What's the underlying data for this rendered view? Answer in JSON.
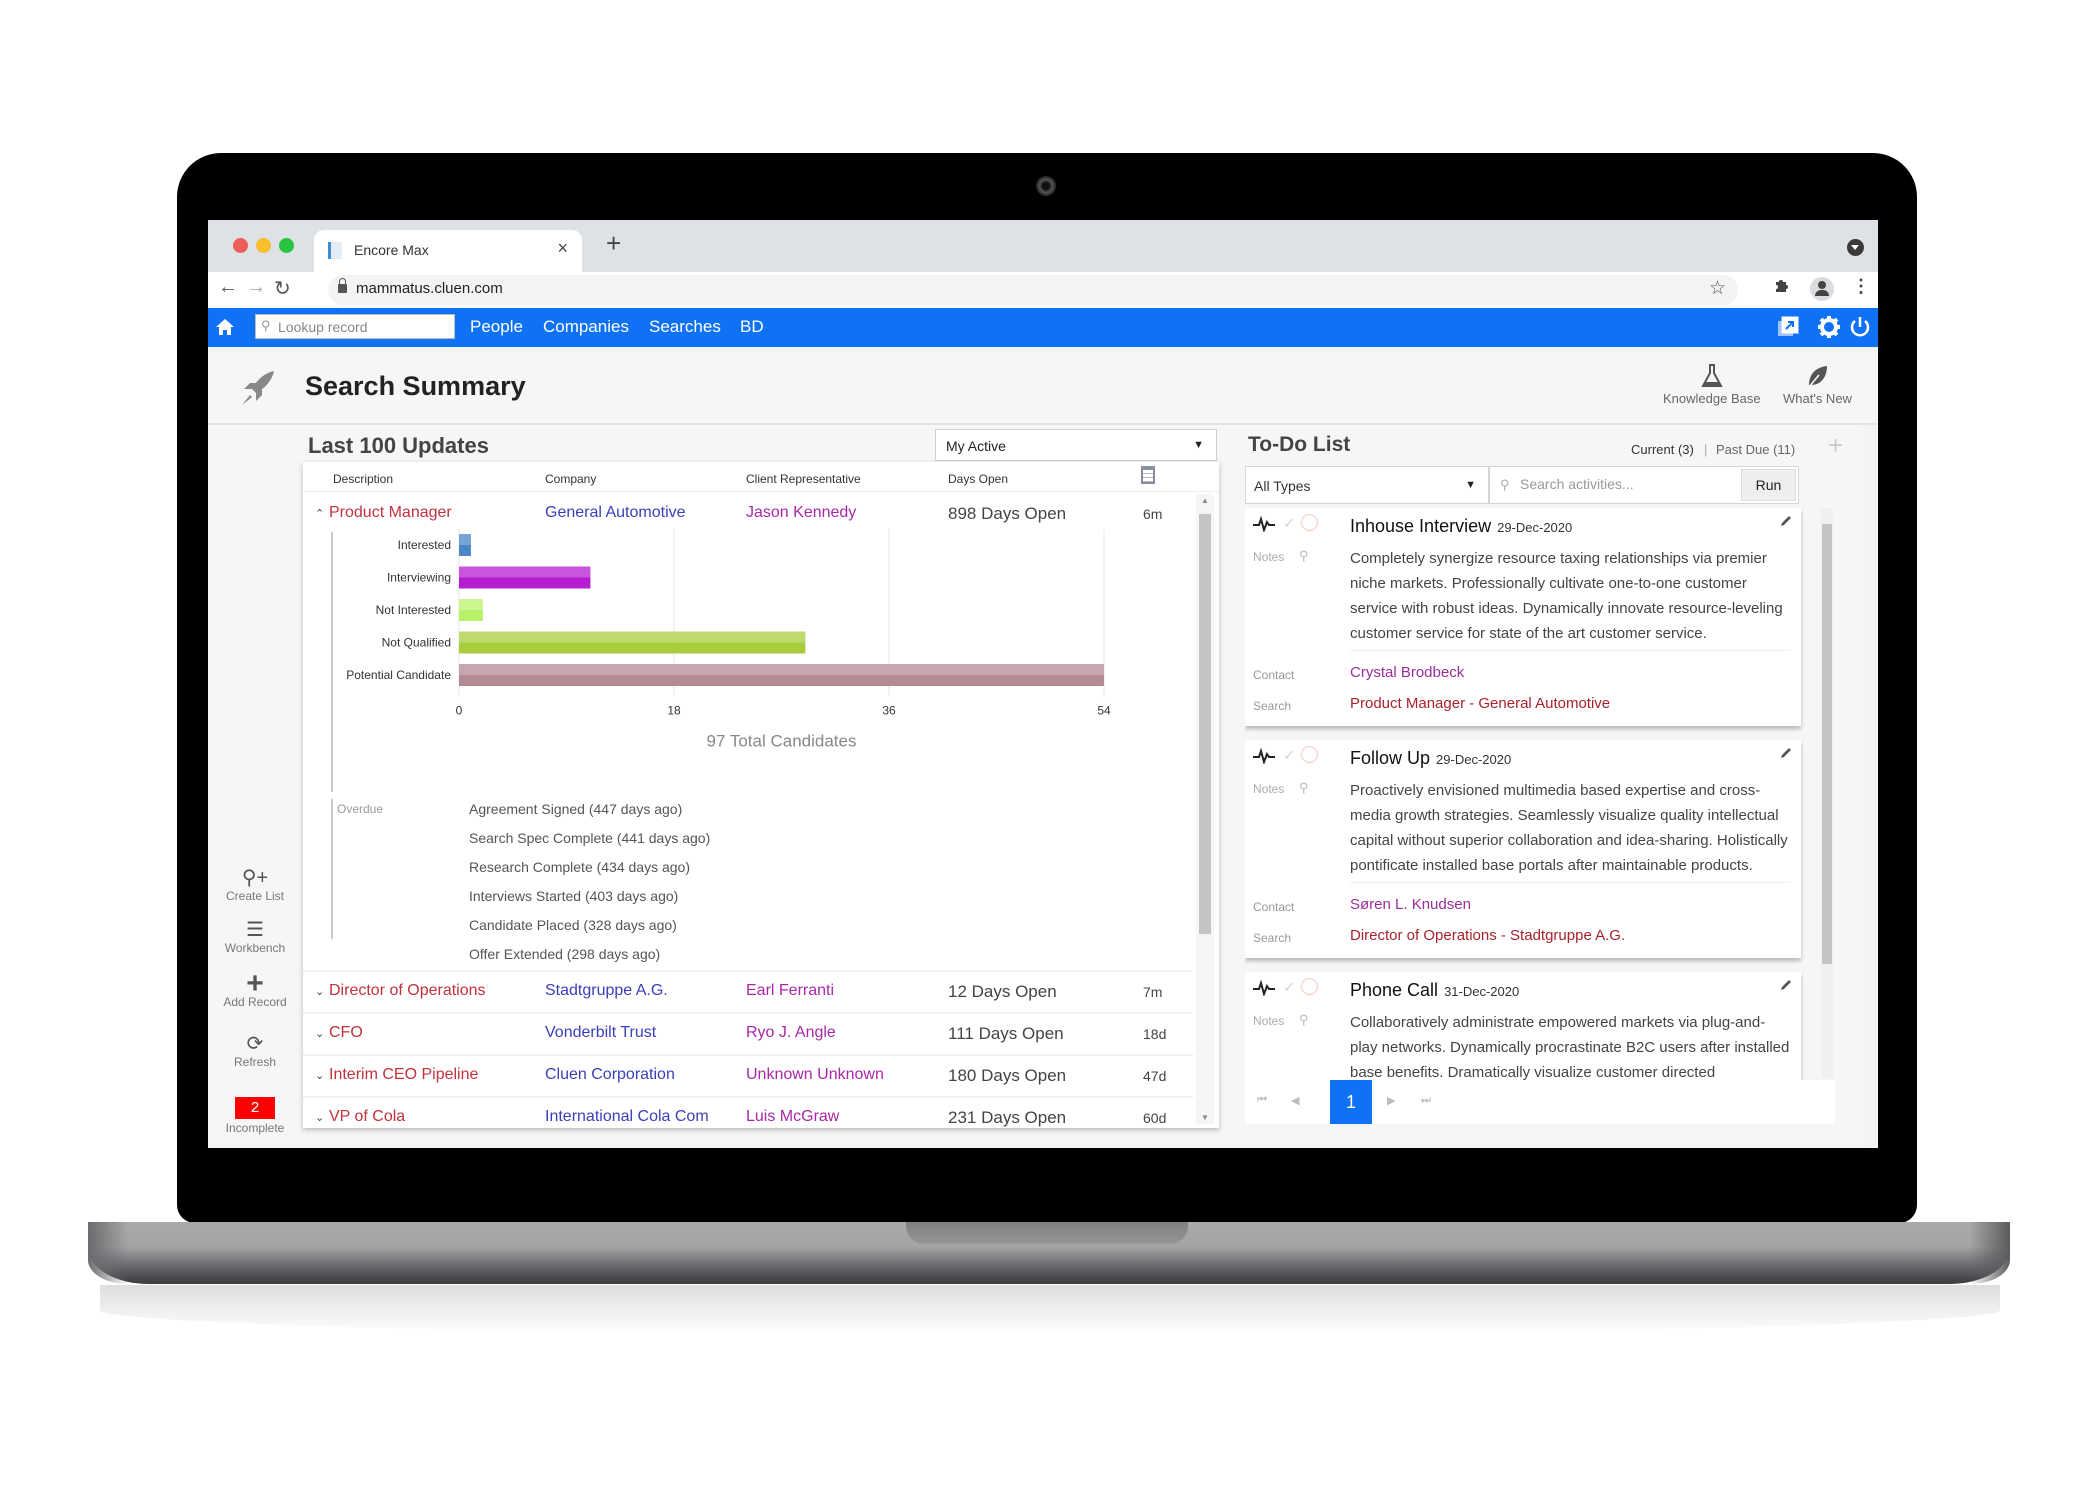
{
  "browser": {
    "tab_title": "Encore Max",
    "url": "mammatus.cluen.com"
  },
  "nav": {
    "lookup_placeholder": "Lookup record",
    "links": [
      "People",
      "Companies",
      "Searches",
      "BD"
    ]
  },
  "header": {
    "title": "Search Summary",
    "tools": [
      {
        "label": "Knowledge Base",
        "icon": "flask-icon"
      },
      {
        "label": "What's New",
        "icon": "leaf-icon"
      }
    ]
  },
  "sidebar": {
    "items": [
      {
        "label": "Create List",
        "icon": "search-plus-icon"
      },
      {
        "label": "Workbench",
        "icon": "list-icon"
      },
      {
        "label": "Add Record",
        "icon": "plus-icon"
      },
      {
        "label": "Refresh",
        "icon": "refresh-icon"
      },
      {
        "label": "Incomplete",
        "badge": "2"
      }
    ]
  },
  "updates": {
    "title": "Last 100 Updates",
    "filter": "My Active",
    "columns": [
      "Description",
      "Company",
      "Client Representative",
      "Days Open"
    ],
    "rows": [
      {
        "description": "Product Manager",
        "company": "General Automotive",
        "rep": "Jason Kennedy",
        "days_open": "898 Days Open",
        "ago": "6m",
        "expanded": true
      },
      {
        "description": "Director of Operations",
        "company": "Stadtgruppe A.G.",
        "rep": "Earl Ferranti",
        "days_open": "12 Days Open",
        "ago": "7m"
      },
      {
        "description": "CFO",
        "company": "Vonderbilt Trust",
        "rep": "Ryo J. Angle",
        "days_open": "111 Days Open",
        "ago": "18d"
      },
      {
        "description": "Interim CEO Pipeline",
        "company": "Cluen Corporation",
        "rep": "Unknown Unknown",
        "days_open": "180 Days Open",
        "ago": "47d"
      },
      {
        "description": "VP of Cola",
        "company": "International Cola Com",
        "rep": "Luis McGraw",
        "days_open": "231 Days Open",
        "ago": "60d"
      }
    ],
    "overdue_label": "Overdue",
    "milestones": [
      "Agreement Signed (447 days ago)",
      "Search Spec Complete (441 days ago)",
      "Research Complete (434 days ago)",
      "Interviews Started (403 days ago)",
      "Candidate Placed (328 days ago)",
      "Offer Extended (298 days ago)"
    ]
  },
  "chart_data": {
    "type": "bar",
    "orientation": "horizontal",
    "categories": [
      "Interested",
      "Interviewing",
      "Not Interested",
      "Not Qualified",
      "Potential Candidate"
    ],
    "values": [
      1,
      11,
      2,
      29,
      54
    ],
    "colors": [
      "#4a86c8",
      "#b61cd0",
      "#b8f26a",
      "#a9cc3c",
      "#b48a94"
    ],
    "title": "",
    "xlabel": "97 Total Candidates",
    "ylabel": "",
    "xlim": [
      0,
      54
    ],
    "xticks": [
      0,
      18,
      36,
      54
    ],
    "grid": true
  },
  "todo": {
    "title": "To-Do List",
    "current_label": "Current (3)",
    "past_due_label": "Past Due (11)",
    "type_filter": "All Types",
    "search_placeholder": "Search activities...",
    "run_label": "Run",
    "labels": {
      "notes": "Notes",
      "contact": "Contact",
      "search": "Search"
    },
    "items": [
      {
        "type": "Inhouse Interview",
        "date": "29-Dec-2020",
        "notes": "Completely synergize resource taxing relationships via premier niche markets. Professionally cultivate one-to-one customer service with robust ideas. Dynamically innovate resource-leveling customer service for state of the art customer service.",
        "contact": "Crystal Brodbeck",
        "search": "Product Manager - General Automotive"
      },
      {
        "type": "Follow Up",
        "date": "29-Dec-2020",
        "notes": "Proactively envisioned multimedia based expertise and cross-media growth strategies. Seamlessly visualize quality intellectual capital without superior collaboration and idea-sharing. Holistically pontificate installed base portals after maintainable products.",
        "contact": "Søren L. Knudsen",
        "search": "Director of Operations - Stadtgruppe A.G."
      },
      {
        "type": "Phone Call",
        "date": "31-Dec-2020",
        "notes": "Collaboratively administrate empowered markets via plug-and-play networks. Dynamically procrastinate B2C users after installed base benefits. Dramatically visualize customer directed convergence"
      }
    ],
    "pager": {
      "current_page": "1"
    }
  },
  "colors": {
    "nav_blue": "#0f72f4",
    "description_red": "#c0323c",
    "company_blue": "#3a3fb8",
    "rep_purple": "#a828a8",
    "badge_red": "#ff0000"
  }
}
